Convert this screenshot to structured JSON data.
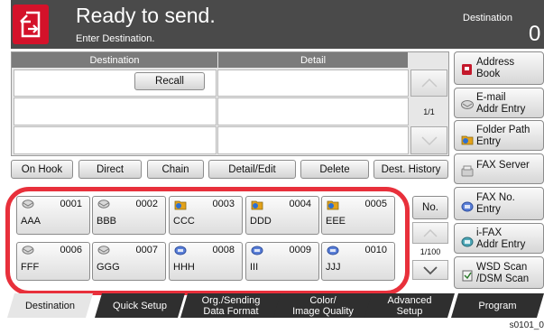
{
  "header": {
    "title": "Ready to send.",
    "subtitle": "Enter Destination.",
    "destination_label": "Destination",
    "destination_count": "0"
  },
  "table": {
    "col_destination": "Destination",
    "col_detail": "Detail",
    "recall_label": "Recall",
    "page": "1/1"
  },
  "actions": {
    "on_hook": "On Hook",
    "direct": "Direct",
    "chain": "Chain",
    "detail_edit": "Detail/Edit",
    "delete": "Delete",
    "dest_history": "Dest. History"
  },
  "side": {
    "address_book": [
      "Address",
      "Book"
    ],
    "email": [
      "E-mail",
      "Addr Entry"
    ],
    "folder": [
      "Folder Path",
      "Entry"
    ],
    "fax_server": "FAX Server",
    "fax_no": [
      "FAX No.",
      "Entry"
    ],
    "ifax": [
      "i-FAX",
      "Addr Entry"
    ],
    "wsd": [
      "WSD Scan",
      "/DSM Scan"
    ]
  },
  "keys": [
    {
      "num": "0001",
      "name": "AAA",
      "icon": "email-icon"
    },
    {
      "num": "0002",
      "name": "BBB",
      "icon": "email-icon"
    },
    {
      "num": "0003",
      "name": "CCC",
      "icon": "folder-icon"
    },
    {
      "num": "0004",
      "name": "DDD",
      "icon": "folder-icon"
    },
    {
      "num": "0005",
      "name": "EEE",
      "icon": "folder-icon"
    },
    {
      "num": "0006",
      "name": "FFF",
      "icon": "email-icon"
    },
    {
      "num": "0007",
      "name": "GGG",
      "icon": "email-icon"
    },
    {
      "num": "0008",
      "name": "HHH",
      "icon": "fax-icon"
    },
    {
      "num": "0009",
      "name": "III",
      "icon": "fax-icon"
    },
    {
      "num": "0010",
      "name": "JJJ",
      "icon": "fax-icon"
    }
  ],
  "onetouch": {
    "no_label": "No.",
    "page": "1/100"
  },
  "tabs": [
    {
      "label": "Destination"
    },
    {
      "label": "Quick Setup"
    },
    {
      "label": "Org./Sending\nData Format"
    },
    {
      "label": "Color/\nImage Quality"
    },
    {
      "label": "Advanced\nSetup"
    },
    {
      "label": "Program"
    }
  ],
  "footnote": "s0101_0",
  "colors": {
    "accent_red": "#d4122a",
    "highlight_frame": "#e8303b",
    "header_bg": "#4a4a4a",
    "tab_bg": "#2f2f2f"
  }
}
